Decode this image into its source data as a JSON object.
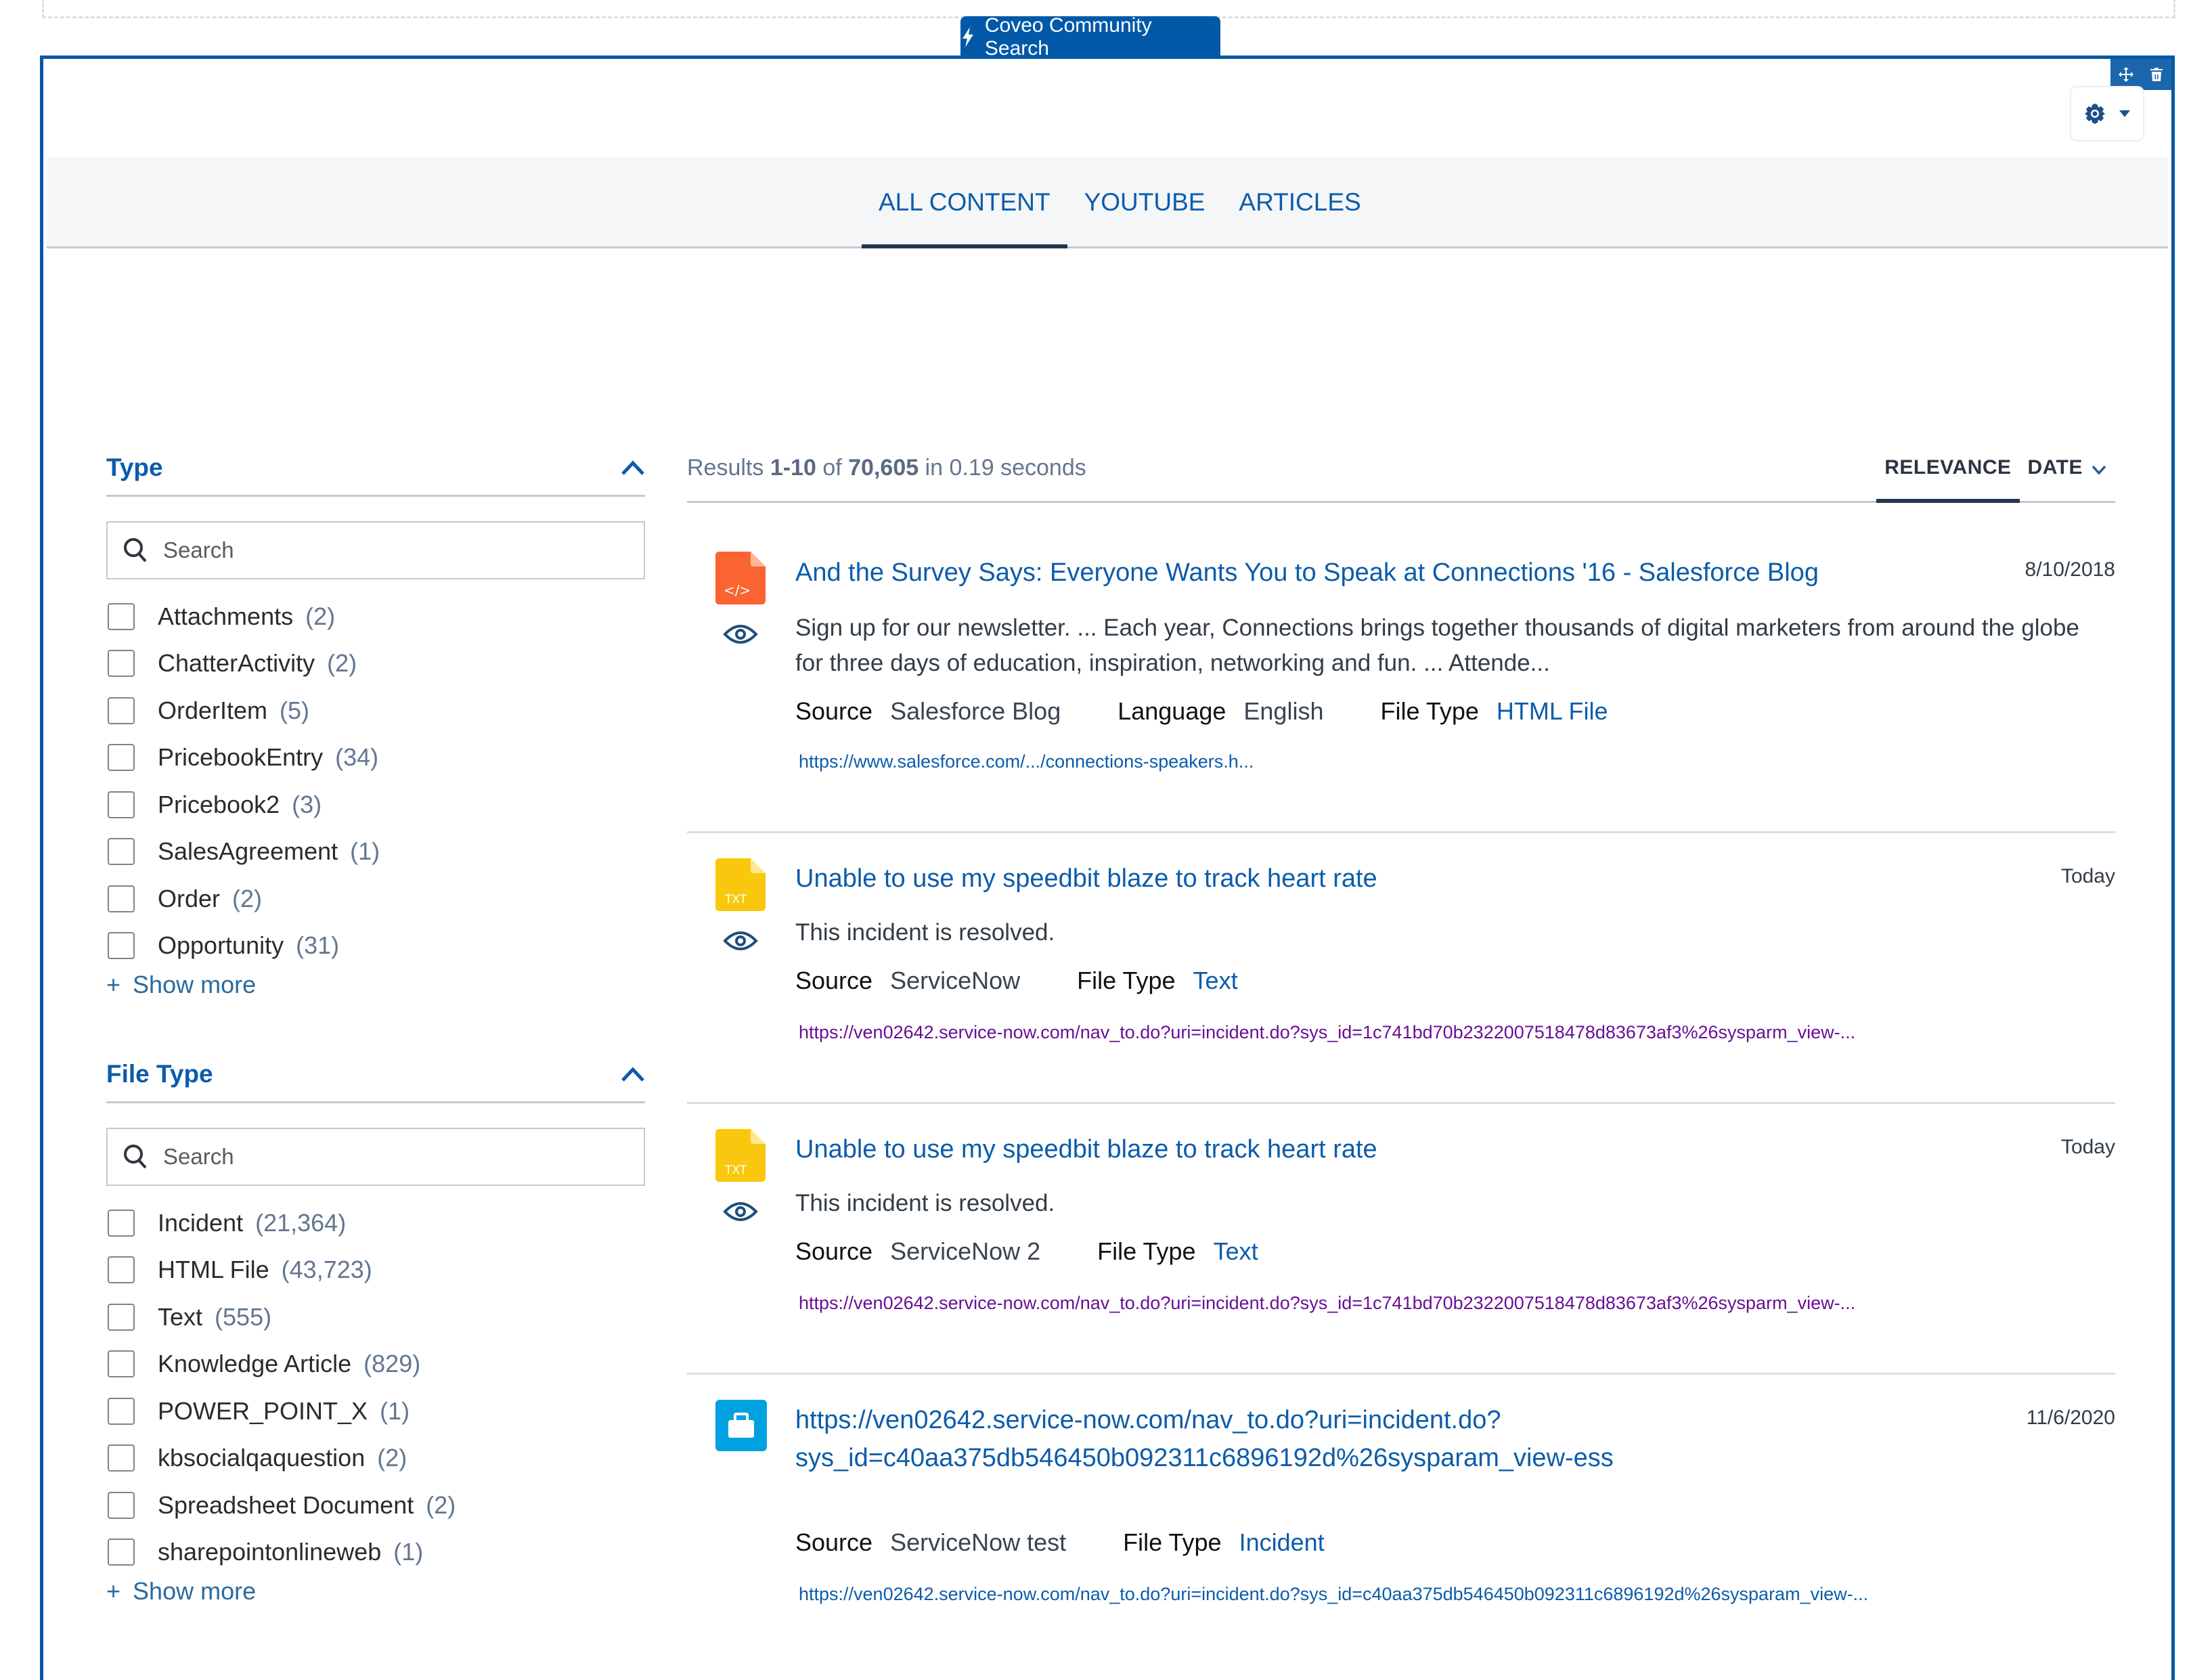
{
  "component_label": "Coveo Community Search",
  "colors": {
    "brand": "#0159a8",
    "link": "#0b5cab",
    "visited_link": "#6a0f96",
    "html_icon": "#f96430",
    "txt_icon": "#f9c80e",
    "incident_icon": "#00a1e0"
  },
  "tabs": [
    {
      "label": "ALL CONTENT",
      "active": true
    },
    {
      "label": "YOUTUBE",
      "active": false
    },
    {
      "label": "ARTICLES",
      "active": false
    }
  ],
  "facets": [
    {
      "title": "Type",
      "search_placeholder": "Search",
      "values": [
        {
          "label": "Attachments",
          "count": "(2)"
        },
        {
          "label": "ChatterActivity",
          "count": "(2)"
        },
        {
          "label": "OrderItem",
          "count": "(5)"
        },
        {
          "label": "PricebookEntry",
          "count": "(34)"
        },
        {
          "label": "Pricebook2",
          "count": "(3)"
        },
        {
          "label": "SalesAgreement",
          "count": "(1)"
        },
        {
          "label": "Order",
          "count": "(2)"
        },
        {
          "label": "Opportunity",
          "count": "(31)"
        }
      ],
      "show_more": "Show more"
    },
    {
      "title": "File Type",
      "search_placeholder": "Search",
      "values": [
        {
          "label": "Incident",
          "count": "(21,364)"
        },
        {
          "label": "HTML File",
          "count": "(43,723)"
        },
        {
          "label": "Text",
          "count": "(555)"
        },
        {
          "label": "Knowledge Article",
          "count": "(829)"
        },
        {
          "label": "POWER_POINT_X",
          "count": "(1)"
        },
        {
          "label": "kbsocialqaquestion",
          "count": "(2)"
        },
        {
          "label": "Spreadsheet Document",
          "count": "(2)"
        },
        {
          "label": "sharepointonlineweb",
          "count": "(1)"
        }
      ],
      "show_more": "Show more"
    }
  ],
  "summary": {
    "prefix": "Results ",
    "range": "1-10",
    "of": " of ",
    "total": "70,605",
    "suffix": " in 0.19 seconds"
  },
  "sort": {
    "relevance": "RELEVANCE",
    "date": "DATE"
  },
  "results": [
    {
      "icon": "html-file-icon",
      "title": "And the Survey Says: Everyone Wants You to Speak at Connections '16 - Salesforce Blog",
      "date": "8/10/2018",
      "excerpt": "Sign up for our newsletter. ... Each year, Connections brings together thousands of digital marketers from around the globe for three days of education, inspiration, networking and fun. ... Attende...",
      "fields": [
        {
          "label": "Source",
          "value": "Salesforce Blog",
          "link": false
        },
        {
          "label": "Language",
          "value": "English",
          "link": false
        },
        {
          "label": "File Type",
          "value": "HTML File",
          "link": true
        }
      ],
      "uri": "https://www.salesforce.com/.../connections-speakers.h..."
    },
    {
      "icon": "txt-file-icon",
      "title": "Unable to use my speedbit blaze to track heart rate",
      "date": "Today",
      "excerpt": "This incident is resolved.",
      "fields": [
        {
          "label": "Source",
          "value": "ServiceNow",
          "link": false
        },
        {
          "label": "File Type",
          "value": "Text",
          "link": true
        }
      ],
      "uri": "https://ven02642.service-now.com/nav_to.do?uri=incident.do?sys_id=1c741bd70b2322007518478d83673af3%26sysparm_view-..."
    },
    {
      "icon": "txt-file-icon",
      "title": "Unable to use my speedbit blaze to track heart rate",
      "date": "Today",
      "excerpt": "This incident is resolved.",
      "fields": [
        {
          "label": "Source",
          "value": "ServiceNow 2",
          "link": false
        },
        {
          "label": "File Type",
          "value": "Text",
          "link": true
        }
      ],
      "uri": "https://ven02642.service-now.com/nav_to.do?uri=incident.do?sys_id=1c741bd70b2322007518478d83673af3%26sysparm_view-..."
    },
    {
      "icon": "incident-briefcase-icon",
      "title_line1": "https://ven02642.service-now.com/nav_to.do?uri=incident.do?",
      "title_line2": "sys_id=c40aa375db546450b092311c6896192d%26sysparam_view-ess",
      "date": "11/6/2020",
      "fields": [
        {
          "label": "Source",
          "value": "ServiceNow test",
          "link": false
        },
        {
          "label": "File Type",
          "value": "Incident",
          "link": true
        }
      ],
      "uri": "https://ven02642.service-now.com/nav_to.do?uri=incident.do?sys_id=c40aa375db546450b092311c6896192d%26sysparam_view-..."
    }
  ]
}
